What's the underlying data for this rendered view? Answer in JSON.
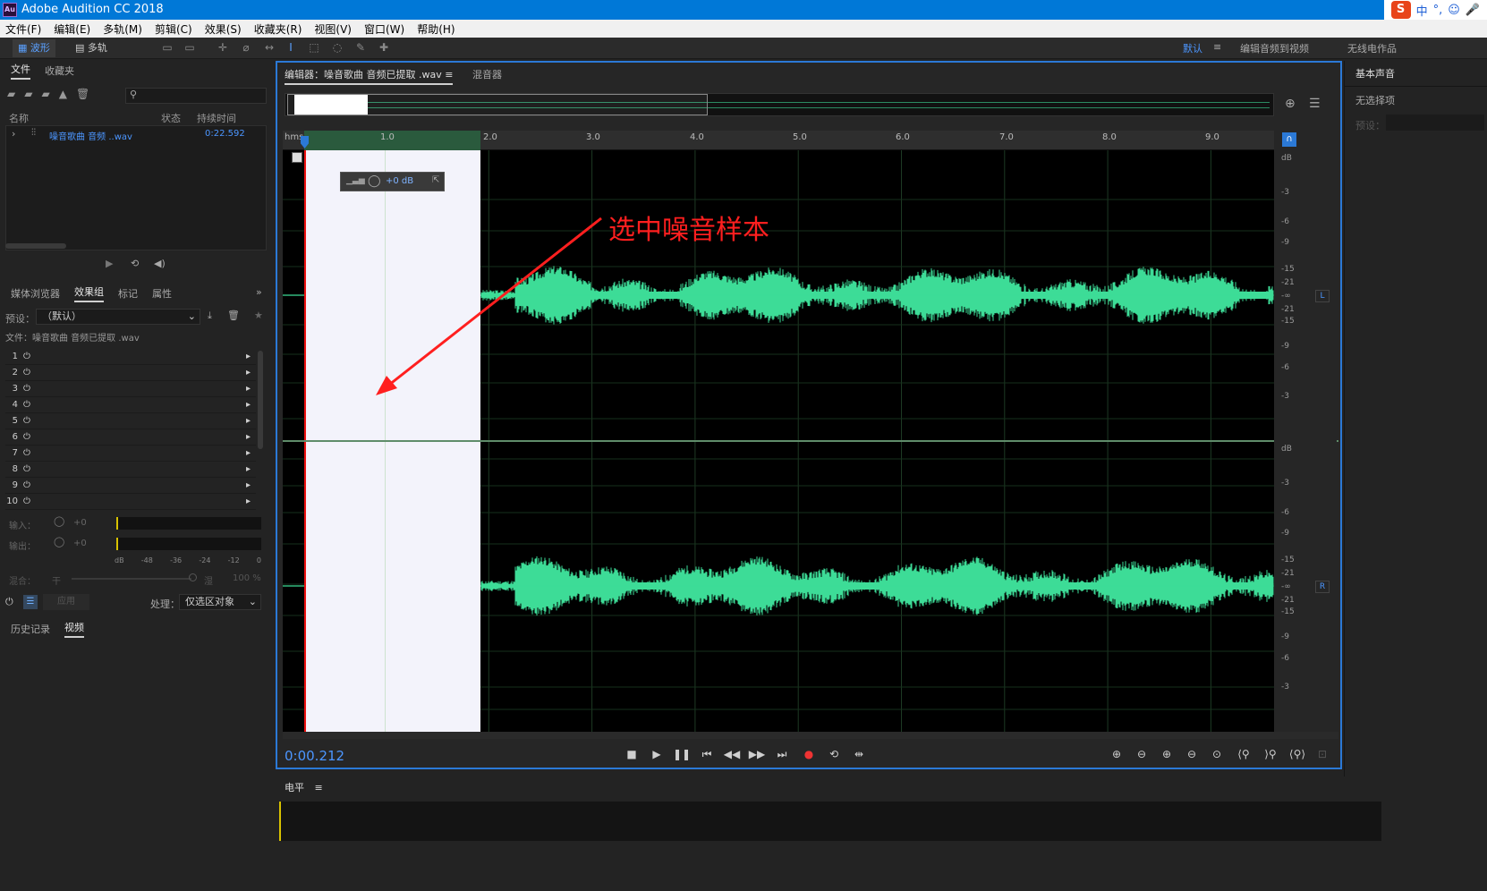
{
  "app": {
    "title": "Adobe Audition CC 2018",
    "logo": "Au"
  },
  "ime": {
    "lang": "中",
    "punct": "°,",
    "emoji": "☺",
    "mic": "🎤"
  },
  "menu": [
    "文件(F)",
    "编辑(E)",
    "多轨(M)",
    "剪辑(C)",
    "效果(S)",
    "收藏夹(R)",
    "视图(V)",
    "窗口(W)",
    "帮助(H)"
  ],
  "toolbar": {
    "waveform": "波形",
    "multitrack": "多轨",
    "workspace_default": "默认",
    "workspace_edit_video": "编辑音频到视频",
    "workspace_radio": "无线电作品"
  },
  "files_panel": {
    "tabs": [
      "文件",
      "收藏夹"
    ],
    "columns": {
      "name": "名称",
      "status": "状态",
      "duration": "持续时间"
    },
    "file": {
      "name": "噪音歌曲 音频 ..wav",
      "duration": "0:22.592"
    }
  },
  "effects_panel": {
    "tabs": [
      "媒体浏览器",
      "效果组",
      "标记",
      "属性"
    ],
    "preset_label": "预设：",
    "preset_value": "（默认）",
    "file_line": "文件：噪音歌曲 音频已提取 .wav",
    "slots": [
      "1",
      "2",
      "3",
      "4",
      "5",
      "6",
      "7",
      "8",
      "9",
      "10"
    ],
    "input_label": "输入：",
    "output_label": "输出：",
    "input_db": "+0",
    "output_db": "+0",
    "meter_ticks": [
      "dB",
      "-48",
      "-36",
      "-24",
      "-12",
      "0"
    ],
    "mix_label": "混合：",
    "dry_label": "干",
    "wet_label": "湿",
    "mix_percent": "100 %",
    "apply_label": "应用",
    "process_label": "处理：",
    "process_value": "仅选区对象"
  },
  "bottom_left_tabs": [
    "历史记录",
    "视频"
  ],
  "editor": {
    "tab_editor": "编辑器：噪音歌曲 音频已提取 .wav",
    "tab_mixer": "混音器",
    "ruler_unit": "hms",
    "ruler_ticks": [
      "1.0",
      "2.0",
      "3.0",
      "4.0",
      "5.0",
      "6.0",
      "7.0",
      "8.0",
      "9.0"
    ],
    "time": "0:00.212",
    "hud_gain": "+0 dB",
    "channel_L": "L",
    "channel_R": "R",
    "db_scale": [
      "dB",
      "-3",
      "-6",
      "-9",
      "-15",
      "-21",
      "-∞",
      "-21",
      "-15",
      "-9",
      "-6",
      "-3"
    ]
  },
  "annotation": {
    "text": "选中噪音样本",
    "color": "#ff1f1f"
  },
  "levels_panel": {
    "title": "电平"
  },
  "right_panel": {
    "title": "基本声音",
    "no_selection": "无选择项",
    "preset": "预设："
  },
  "colors": {
    "waveform": "#3ddc97",
    "selection": "#f3f3fb",
    "accent": "#2b79d6",
    "time": "#4c96ff"
  }
}
